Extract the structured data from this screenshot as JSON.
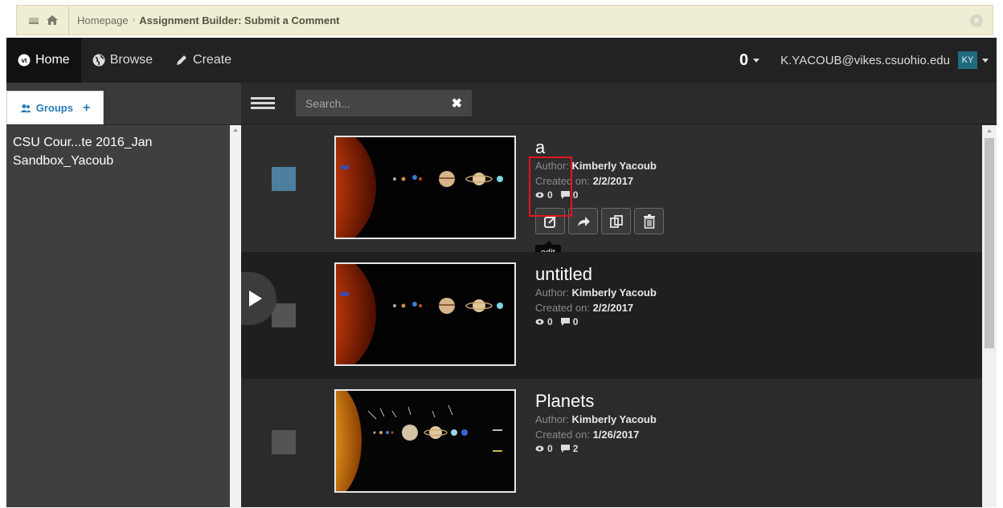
{
  "breadcrumb": {
    "home_label": "Homepage",
    "separator": "›",
    "current": "Assignment Builder: Submit a Comment"
  },
  "nav": {
    "home": "Home",
    "browse": "Browse",
    "create": "Create",
    "notifications_count": "0",
    "user_email": "K.YACOUB@vikes.csuohio.edu",
    "avatar_initials": "KY"
  },
  "sidebar": {
    "tab_label": "Groups",
    "tab_add": "+",
    "groups": [
      "CSU Cour...te 2016_Jan",
      "Sandbox_Yacoub"
    ]
  },
  "toolbar": {
    "search_placeholder": "Search...",
    "clear": "✖"
  },
  "items": [
    {
      "title": "a",
      "author_label": "Author:",
      "author": "Kimberly Yacoub",
      "created_label": "Created on:",
      "created": "2/2/2017",
      "views": "0",
      "comments": "0",
      "selected": true
    },
    {
      "title": "untitled",
      "author_label": "Author:",
      "author": "Kimberly Yacoub",
      "created_label": "Created on:",
      "created": "2/2/2017",
      "views": "0",
      "comments": "0",
      "selected": false
    },
    {
      "title": "Planets",
      "author_label": "Author:",
      "author": "Kimberly Yacoub",
      "created_label": "Created on:",
      "created": "1/26/2017",
      "views": "0",
      "comments": "2",
      "selected": false
    }
  ],
  "tooltip": "edit",
  "colors": {
    "accent": "#2a7cb8",
    "highlight": "#e0151b",
    "selected_checkbox": "#4e7f9e"
  }
}
